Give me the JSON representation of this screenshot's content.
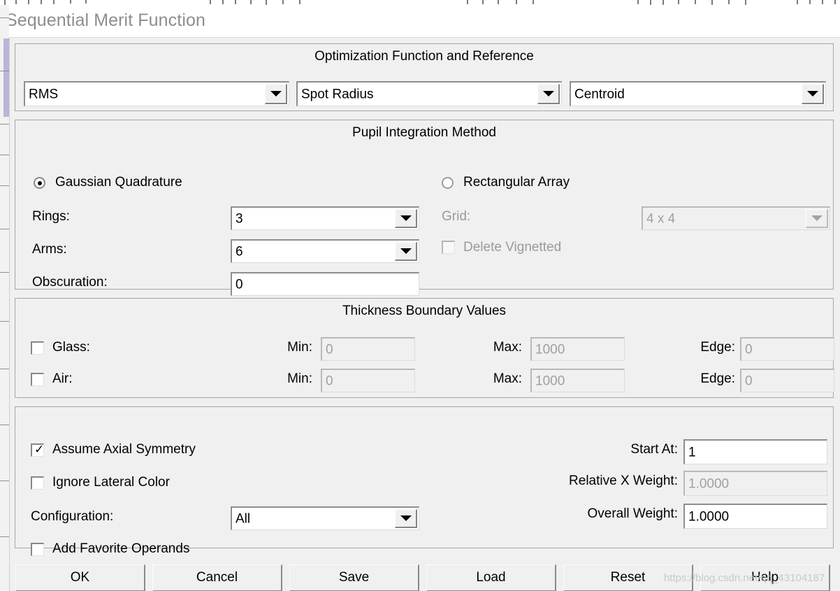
{
  "window": {
    "title": "Sequential Merit Function"
  },
  "optimization_group": {
    "title": "Optimization Function and Reference",
    "fields": [
      {
        "name": "merit-type",
        "value": "RMS"
      },
      {
        "name": "criterion",
        "value": "Spot Radius"
      },
      {
        "name": "reference",
        "value": "Centroid"
      }
    ]
  },
  "pupil_group": {
    "title": "Pupil Integration Method",
    "gaussian": {
      "radio_label": "Gaussian Quadrature",
      "selected": true,
      "rings_label": "Rings:",
      "rings_value": "3",
      "arms_label": "Arms:",
      "arms_value": "6",
      "obscuration_label": "Obscuration:",
      "obscuration_value": "0"
    },
    "rectangular": {
      "radio_label": "Rectangular Array",
      "selected": false,
      "grid_label": "Grid:",
      "grid_value": "4 x 4",
      "delete_vignetted_label": "Delete Vignetted",
      "delete_vignetted_checked": false
    }
  },
  "thickness_group": {
    "title": "Thickness Boundary Values",
    "min_label": "Min:",
    "max_label": "Max:",
    "edge_label": "Edge:",
    "rows": [
      {
        "name": "glass",
        "label": "Glass:",
        "checked": false,
        "min": "0",
        "max": "1000",
        "edge": "0"
      },
      {
        "name": "air",
        "label": "Air:",
        "checked": false,
        "min": "0",
        "max": "1000",
        "edge": "0"
      }
    ]
  },
  "options_group": {
    "assume_axial_symmetry": {
      "label": "Assume Axial Symmetry",
      "checked": true
    },
    "ignore_lateral_color": {
      "label": "Ignore Lateral Color",
      "checked": false
    },
    "configuration": {
      "label": "Configuration:",
      "value": "All"
    },
    "add_favorite_operands": {
      "label": "Add Favorite Operands",
      "checked": false
    },
    "start_at": {
      "label": "Start At:",
      "value": "1",
      "enabled": true
    },
    "relative_x_weight": {
      "label": "Relative X Weight:",
      "value": "1.0000",
      "enabled": false
    },
    "overall_weight": {
      "label": "Overall Weight:",
      "value": "1.0000",
      "enabled": true
    }
  },
  "buttons": [
    {
      "name": "ok",
      "label": "OK"
    },
    {
      "name": "cancel",
      "label": "Cancel"
    },
    {
      "name": "save",
      "label": "Save"
    },
    {
      "name": "load",
      "label": "Load"
    },
    {
      "name": "reset",
      "label": "Reset"
    },
    {
      "name": "help",
      "label": "Help"
    }
  ],
  "watermark": "https://blog.csdn.net/qq_43104187"
}
